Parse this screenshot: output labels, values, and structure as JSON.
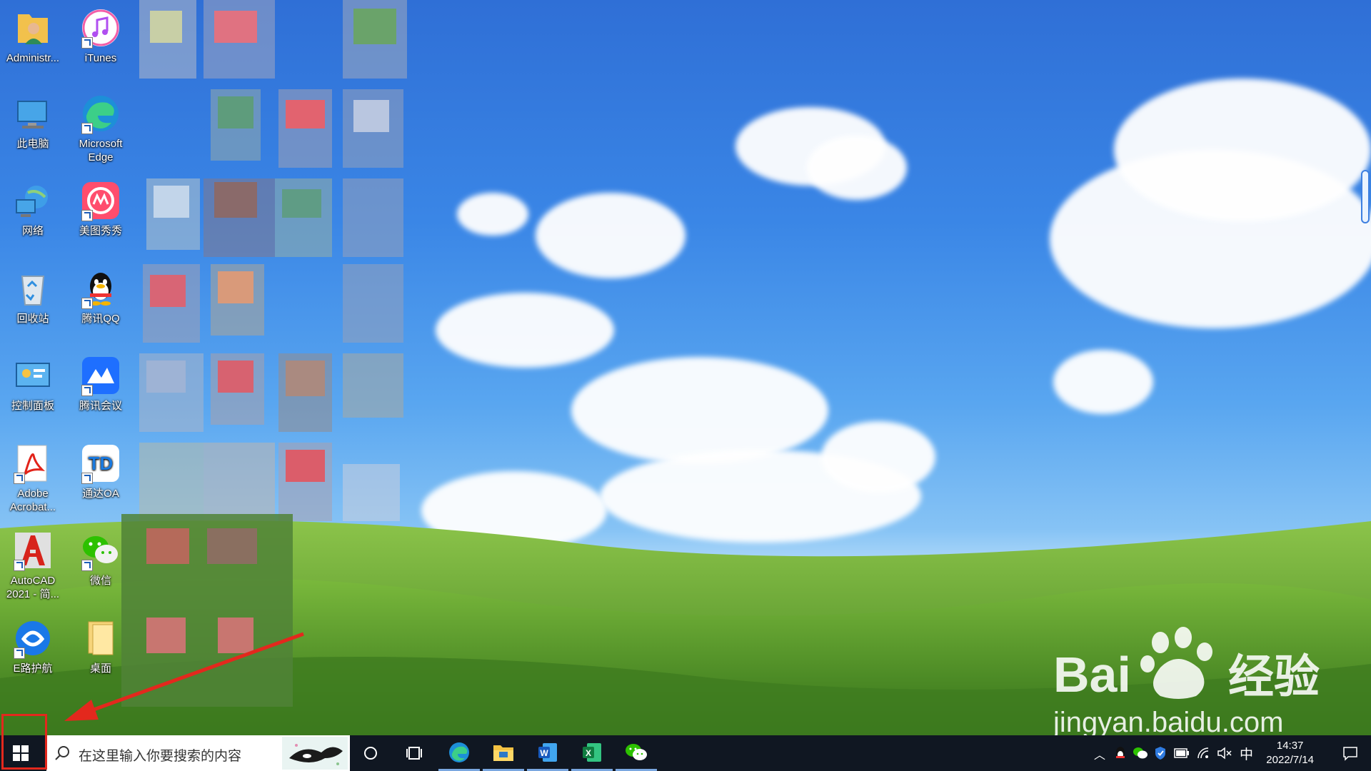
{
  "desktop": {
    "icons": [
      {
        "label": "Administr...",
        "icon": "user-folder-icon"
      },
      {
        "label": "iTunes",
        "icon": "itunes-icon"
      },
      {
        "label": "此电脑",
        "icon": "this-pc-icon"
      },
      {
        "label": "Microsoft Edge",
        "icon": "edge-icon"
      },
      {
        "label": "网络",
        "icon": "network-icon"
      },
      {
        "label": "美图秀秀",
        "icon": "meitu-icon"
      },
      {
        "label": "回收站",
        "icon": "recycle-bin-icon"
      },
      {
        "label": "腾讯QQ",
        "icon": "qq-penguin-icon"
      },
      {
        "label": "控制面板",
        "icon": "control-panel-icon"
      },
      {
        "label": "腾讯会议",
        "icon": "tencent-meeting-icon"
      },
      {
        "label": "Adobe Acrobat...",
        "icon": "acrobat-icon"
      },
      {
        "label": "通达OA",
        "icon": "tongda-oa-icon"
      },
      {
        "label": "AutoCAD 2021 - 简...",
        "icon": "autocad-icon"
      },
      {
        "label": "微信",
        "icon": "wechat-icon"
      },
      {
        "label": "E路护航",
        "icon": "elu-huhang-icon"
      },
      {
        "label": "桌面",
        "icon": "folder-icon"
      }
    ]
  },
  "taskbar": {
    "search_placeholder": "在这里输入你要搜索的内容",
    "apps": [
      "cortana-icon",
      "task-view-icon",
      "edge-icon",
      "file-explorer-icon",
      "word-icon",
      "excel-icon",
      "wechat-icon"
    ],
    "tray": {
      "ime": "中",
      "time": "14:37",
      "date": "2022/7/14"
    }
  },
  "watermark": {
    "brand": "Bai",
    "brand_cn": "经验",
    "url": "jingyan.baidu.com"
  },
  "colors": {
    "taskbar_bg": "#101722",
    "annotation_red": "#e3281d",
    "sky_blue": "#3a86e6",
    "grass_green": "#5f9e2b"
  }
}
